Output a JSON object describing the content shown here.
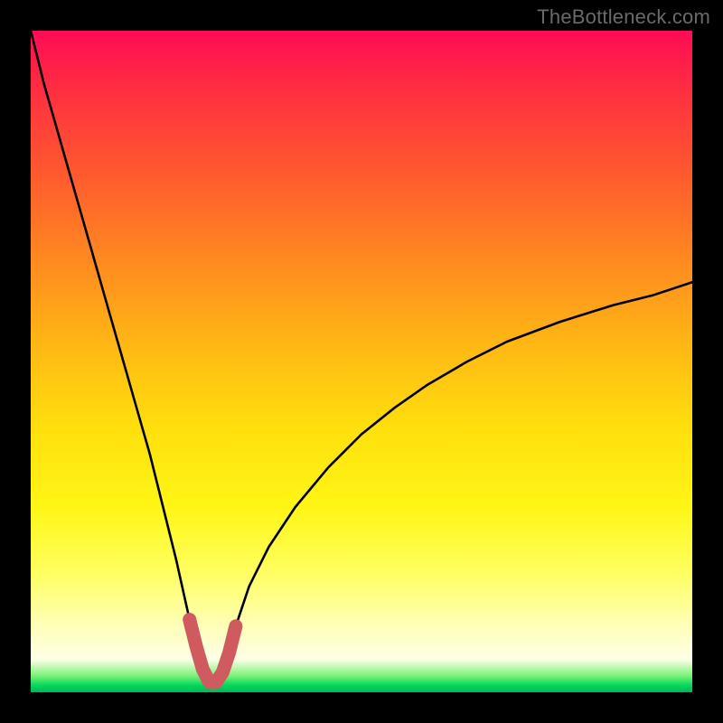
{
  "watermark": "TheBottleneck.com",
  "colors": {
    "frame": "#000000",
    "curve": "#000000",
    "highlight": "#cf5a5f",
    "gradient_stops": [
      "#ff0b56",
      "#ff2b42",
      "#ff5b2e",
      "#ff8e1f",
      "#ffb914",
      "#ffdf0d",
      "#fff615",
      "#ffff62",
      "#ffffb8",
      "#ffffe8",
      "#7bf27a",
      "#00d65a",
      "#00b85a"
    ]
  },
  "chart_data": {
    "type": "line",
    "title": "",
    "xlabel": "",
    "ylabel": "",
    "xlim": [
      0,
      100
    ],
    "ylim": [
      0,
      100
    ],
    "grid": false,
    "legend": false,
    "notes": "V-shaped bottleneck curve. Minimum (~0) near x≈27. Left branch rises steeply to y≈100 at x=0; right branch rises with decreasing slope to y≈62 at x=100. Red highlight near the valley floor between x≈24 and x≈31.",
    "series": [
      {
        "name": "bottleneck-curve",
        "x": [
          0,
          2,
          4,
          6,
          8,
          10,
          12,
          14,
          16,
          18,
          20,
          22,
          24,
          25,
          26,
          27,
          28,
          29,
          30,
          31,
          33,
          36,
          40,
          45,
          50,
          55,
          60,
          66,
          72,
          80,
          88,
          94,
          100
        ],
        "y": [
          100,
          92,
          85,
          78,
          71,
          64,
          57,
          50,
          43,
          36,
          28,
          20,
          11,
          7,
          3.5,
          1.5,
          1.5,
          3,
          6,
          10,
          16,
          22,
          28,
          34,
          39,
          43,
          46.5,
          50,
          53,
          56,
          58.5,
          60,
          62
        ]
      }
    ],
    "highlight": {
      "name": "valley-highlight",
      "x": [
        24,
        25,
        26,
        27,
        28,
        29,
        30,
        31
      ],
      "y": [
        11,
        7,
        3.5,
        1.5,
        1.5,
        3,
        6,
        10
      ],
      "color": "#cf5a5f"
    }
  }
}
